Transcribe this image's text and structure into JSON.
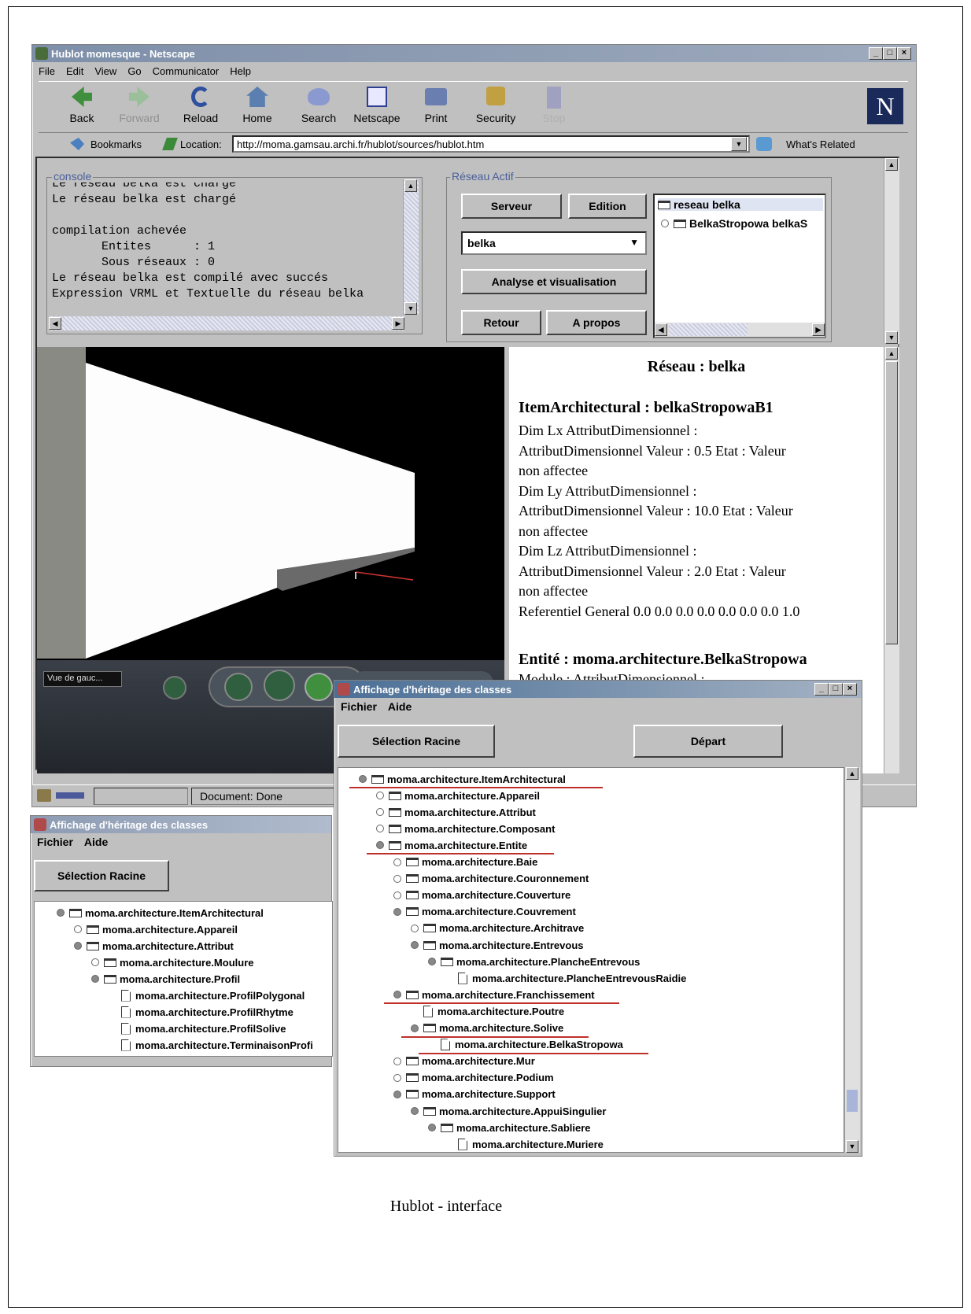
{
  "caption": "Hublot - interface",
  "netscape": {
    "title": "Hublot momesque - Netscape",
    "menu": [
      "File",
      "Edit",
      "View",
      "Go",
      "Communicator",
      "Help"
    ],
    "toolbar": [
      "Back",
      "Forward",
      "Reload",
      "Home",
      "Search",
      "Netscape",
      "Print",
      "Security",
      "Stop"
    ],
    "bookmarks_label": "Bookmarks",
    "location_label": "Location:",
    "location_value": "http://moma.gamsau.archi.fr/hublot/sources/hublot.htm",
    "whats_related": "What's Related",
    "status": "Document: Done",
    "console": {
      "legend": "console",
      "lines": [
        "Le réseau belka est chargé",
        "Le réseau belka est chargé",
        "",
        "compilation achevée",
        "       Entites      : 1",
        "       Sous réseaux : 0",
        "Le réseau belka est compilé avec succés",
        "Expression VRML et Textuelle du réseau belka"
      ]
    },
    "reseau_actif": {
      "legend": "Réseau Actif",
      "btn_serveur": "Serveur",
      "btn_edition": "Edition",
      "select_value": "belka",
      "btn_analyse": "Analyse et visualisation",
      "btn_retour": "Retour",
      "btn_apropos": "A propos",
      "tree_root": "reseau belka",
      "tree_child": "BelkaStropowa belkaS"
    },
    "vrml": {
      "viewpoint": "Vue de gauc..."
    },
    "info": {
      "heading": "Réseau : belka",
      "item_title": "ItemArchitectural : belkaStropowaB1",
      "lines": [
        "Dim Lx AttributDimensionnel :",
        "AttributDimensionnel Valeur : 0.5 Etat : Valeur",
        "non affectee",
        "Dim Ly AttributDimensionnel :",
        "AttributDimensionnel Valeur : 10.0 Etat : Valeur",
        "non affectee",
        "Dim Lz AttributDimensionnel :",
        "AttributDimensionnel Valeur : 2.0 Etat : Valeur",
        "non affectee",
        "Referentiel General 0.0 0.0 0.0 0.0 0.0 0.0 0.0 1.0"
      ],
      "entite_title": "Entité : moma.architecture.BelkaStropowa",
      "entite_line": "Module : AttributDimensionnel :"
    }
  },
  "heritage_left": {
    "title": "Affichage d'héritage des classes",
    "menu": [
      "Fichier",
      "Aide"
    ],
    "btn_selection": "Sélection Racine",
    "nodes": [
      {
        "label": "moma.architecture.ItemArchitectural",
        "depth": 0,
        "kind": "filled"
      },
      {
        "label": "moma.architecture.Appareil",
        "depth": 1,
        "kind": "open"
      },
      {
        "label": "moma.architecture.Attribut",
        "depth": 1,
        "kind": "filled"
      },
      {
        "label": "moma.architecture.Moulure",
        "depth": 2,
        "kind": "open"
      },
      {
        "label": "moma.architecture.Profil",
        "depth": 2,
        "kind": "filled"
      },
      {
        "label": "moma.architecture.ProfilPolygonal",
        "depth": 3,
        "kind": "doc"
      },
      {
        "label": "moma.architecture.ProfilRhytme",
        "depth": 3,
        "kind": "doc"
      },
      {
        "label": "moma.architecture.ProfilSolive",
        "depth": 3,
        "kind": "doc"
      },
      {
        "label": "moma.architecture.TerminaisonProfi",
        "depth": 3,
        "kind": "doc"
      }
    ]
  },
  "heritage_right": {
    "title": "Affichage d'héritage des classes",
    "menu": [
      "Fichier",
      "Aide"
    ],
    "btn_selection": "Sélection Racine",
    "btn_depart": "Départ",
    "nodes": [
      {
        "label": "moma.architecture.ItemArchitectural",
        "depth": 0,
        "kind": "filled",
        "u": true
      },
      {
        "label": "moma.architecture.Appareil",
        "depth": 1,
        "kind": "open"
      },
      {
        "label": "moma.architecture.Attribut",
        "depth": 1,
        "kind": "open"
      },
      {
        "label": "moma.architecture.Composant",
        "depth": 1,
        "kind": "open"
      },
      {
        "label": "moma.architecture.Entite",
        "depth": 1,
        "kind": "filled",
        "u": true
      },
      {
        "label": "moma.architecture.Baie",
        "depth": 2,
        "kind": "open"
      },
      {
        "label": "moma.architecture.Couronnement",
        "depth": 2,
        "kind": "open"
      },
      {
        "label": "moma.architecture.Couverture",
        "depth": 2,
        "kind": "open"
      },
      {
        "label": "moma.architecture.Couvrement",
        "depth": 2,
        "kind": "filled"
      },
      {
        "label": "moma.architecture.Architrave",
        "depth": 3,
        "kind": "open"
      },
      {
        "label": "moma.architecture.Entrevous",
        "depth": 3,
        "kind": "filled"
      },
      {
        "label": "moma.architecture.PlancheEntrevous",
        "depth": 4,
        "kind": "filled"
      },
      {
        "label": "moma.architecture.PlancheEntrevousRaidie",
        "depth": 5,
        "kind": "doc"
      },
      {
        "label": "moma.architecture.Franchissement",
        "depth": 2,
        "kind": "filled",
        "u": true
      },
      {
        "label": "moma.architecture.Poutre",
        "depth": 3,
        "kind": "doc"
      },
      {
        "label": "moma.architecture.Solive",
        "depth": 3,
        "kind": "filled",
        "u": true
      },
      {
        "label": "moma.architecture.BelkaStropowa",
        "depth": 4,
        "kind": "doc",
        "u": true
      },
      {
        "label": "moma.architecture.Mur",
        "depth": 2,
        "kind": "open"
      },
      {
        "label": "moma.architecture.Podium",
        "depth": 2,
        "kind": "open"
      },
      {
        "label": "moma.architecture.Support",
        "depth": 2,
        "kind": "filled"
      },
      {
        "label": "moma.architecture.AppuiSingulier",
        "depth": 3,
        "kind": "filled"
      },
      {
        "label": "moma.architecture.Sabliere",
        "depth": 4,
        "kind": "filled"
      },
      {
        "label": "moma.architecture.Muriere",
        "depth": 5,
        "kind": "doc"
      }
    ]
  }
}
